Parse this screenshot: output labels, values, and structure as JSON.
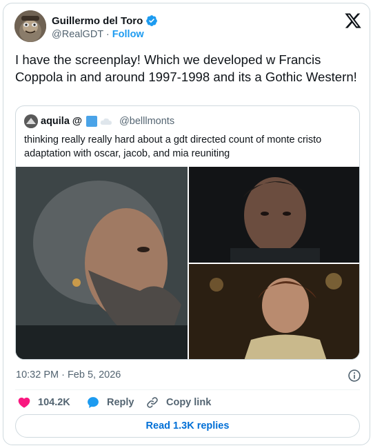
{
  "author": {
    "name": "Guillermo del Toro",
    "handle": "@RealGDT",
    "separator": "·",
    "follow_label": "Follow"
  },
  "tweet": {
    "text": "I have the screenplay!  Which we developed w Francis Coppola in and around 1997-1998 and its a Gothic Western!"
  },
  "quoted": {
    "name": "aquila @",
    "handle": "@belllmonts",
    "text": "thinking really really hard about a gdt directed count of monte cristo adaptation with oscar, jacob, and mia reuniting"
  },
  "meta": {
    "timestamp": "10:32 PM · Feb 5, 2026"
  },
  "actions": {
    "like_count": "104.2K",
    "reply_label": "Reply",
    "copy_label": "Copy link",
    "read_replies_label": "Read 1.3K replies"
  },
  "colors": {
    "accent": "#1d9bf0",
    "like": "#f91880",
    "link": "#006fd6",
    "muted": "#536471",
    "border": "#cfd9de"
  },
  "icons": [
    "verified-badge-icon",
    "x-logo-icon",
    "square-emoji-icon",
    "cloud-emoji-icon",
    "info-icon",
    "heart-icon",
    "reply-bubble-icon",
    "link-icon"
  ]
}
